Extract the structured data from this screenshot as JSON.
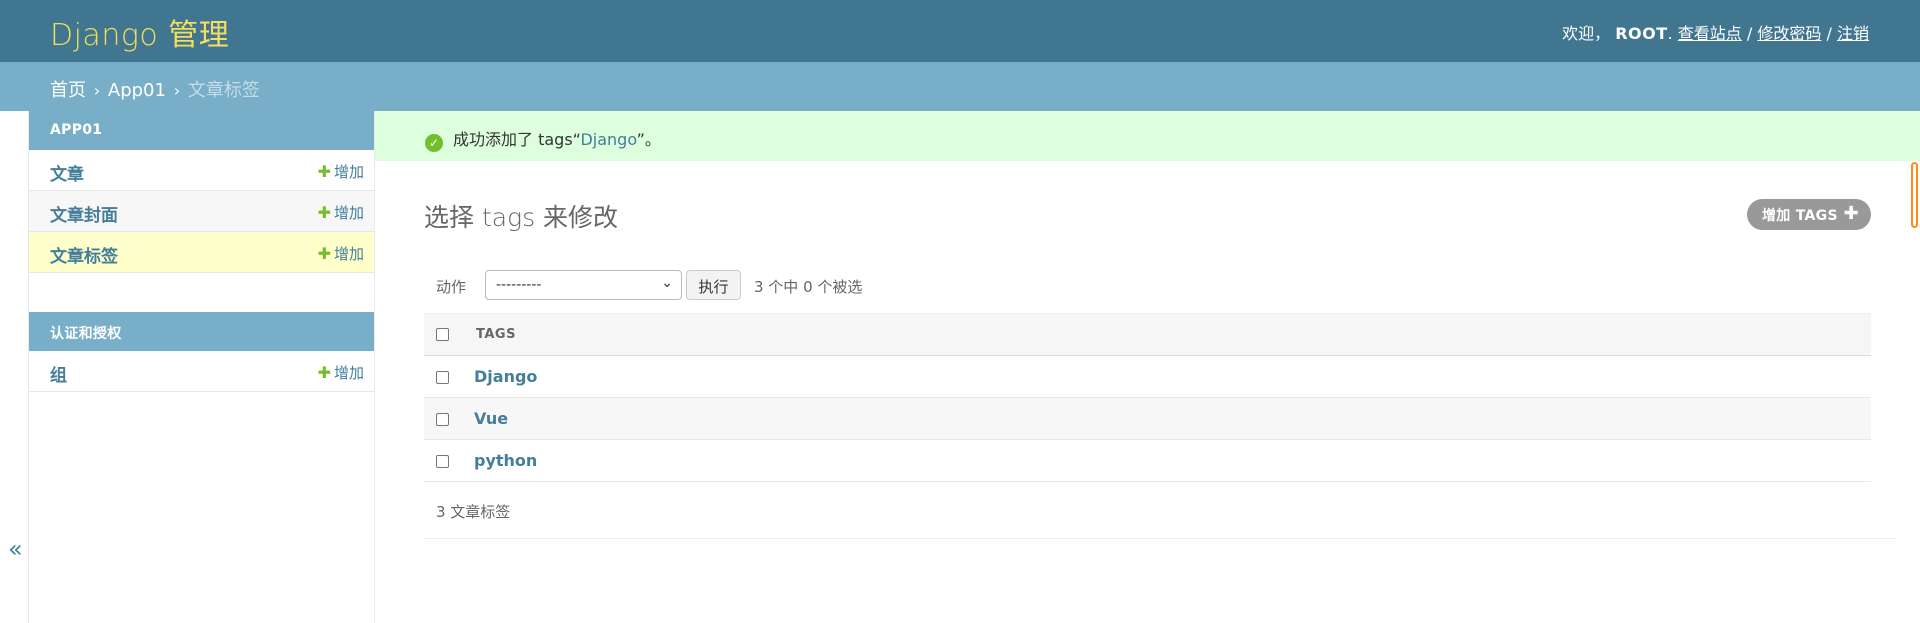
{
  "header": {
    "branding": "Django 管理",
    "welcome": "欢迎，",
    "username": "ROOT",
    "view_site": "查看站点",
    "change_password": "修改密码",
    "logout": "注销",
    "separator": "/"
  },
  "breadcrumbs": {
    "home": "首页",
    "app": "App01",
    "current": "文章标签",
    "sep": "›"
  },
  "toggle_nav": {
    "label": "«"
  },
  "sidebar": {
    "modules": [
      {
        "caption": "APP01",
        "rows": [
          {
            "name": "文章",
            "add": "增加"
          },
          {
            "name": "文章封面",
            "add": "增加"
          },
          {
            "name": "文章标签",
            "add": "增加"
          }
        ]
      },
      {
        "caption": "认证和授权",
        "rows": [
          {
            "name": "组",
            "add": "增加"
          }
        ]
      }
    ]
  },
  "message": {
    "prefix": "成功添加了 tags“",
    "link": "Django",
    "suffix": "”。"
  },
  "main": {
    "title": "选择 tags 来修改",
    "add_button": "增加 TAGS",
    "actions": {
      "label": "动作",
      "select_value": "---------",
      "go": "执行",
      "counter": "3 个中 0 个被选"
    },
    "table": {
      "header": "TAGS",
      "rows": [
        "Django",
        "Vue",
        "python"
      ]
    },
    "paginator": "3 文章标签"
  },
  "colors": {
    "header_bg": "#417690",
    "branding": "#f5dd5d",
    "breadcrumbs_bg": "#79aec8",
    "link": "#447e9b",
    "success_bg": "#ddffdd",
    "add_green": "#70bf2b"
  }
}
